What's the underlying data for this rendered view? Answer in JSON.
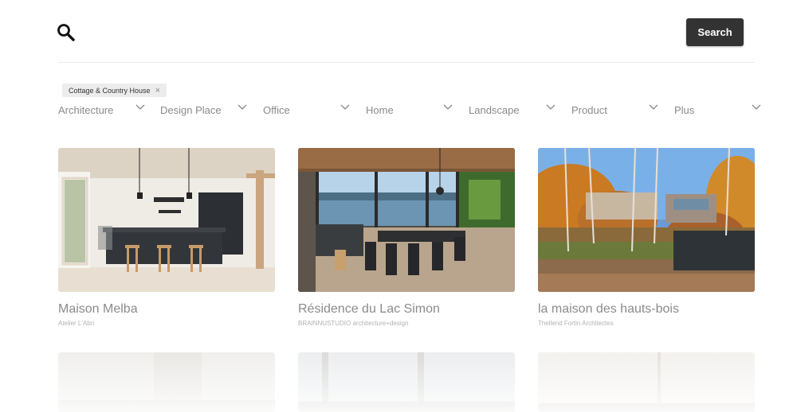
{
  "header": {
    "search_icon": "search-icon",
    "search_button": "Search"
  },
  "active_tag": {
    "label": "Cottage & Country House",
    "remove_glyph": "×"
  },
  "filters": [
    {
      "label": "Architecture"
    },
    {
      "label": "Design Place"
    },
    {
      "label": "Office"
    },
    {
      "label": "Home"
    },
    {
      "label": "Landscape"
    },
    {
      "label": "Product"
    },
    {
      "label": "Plus"
    }
  ],
  "projects": [
    {
      "title": "Maison Melba",
      "studio": "Atelier L'Abri"
    },
    {
      "title": "Résidence du Lac Simon",
      "studio": "BRAINNUSTUDIO architecture+design"
    },
    {
      "title": "la maison des hauts-bois",
      "studio": "Thellend Fortin Architectes"
    }
  ],
  "colors": {
    "button_bg": "#333333",
    "muted_text": "#8b8b8b",
    "tag_bg": "#ececec"
  }
}
